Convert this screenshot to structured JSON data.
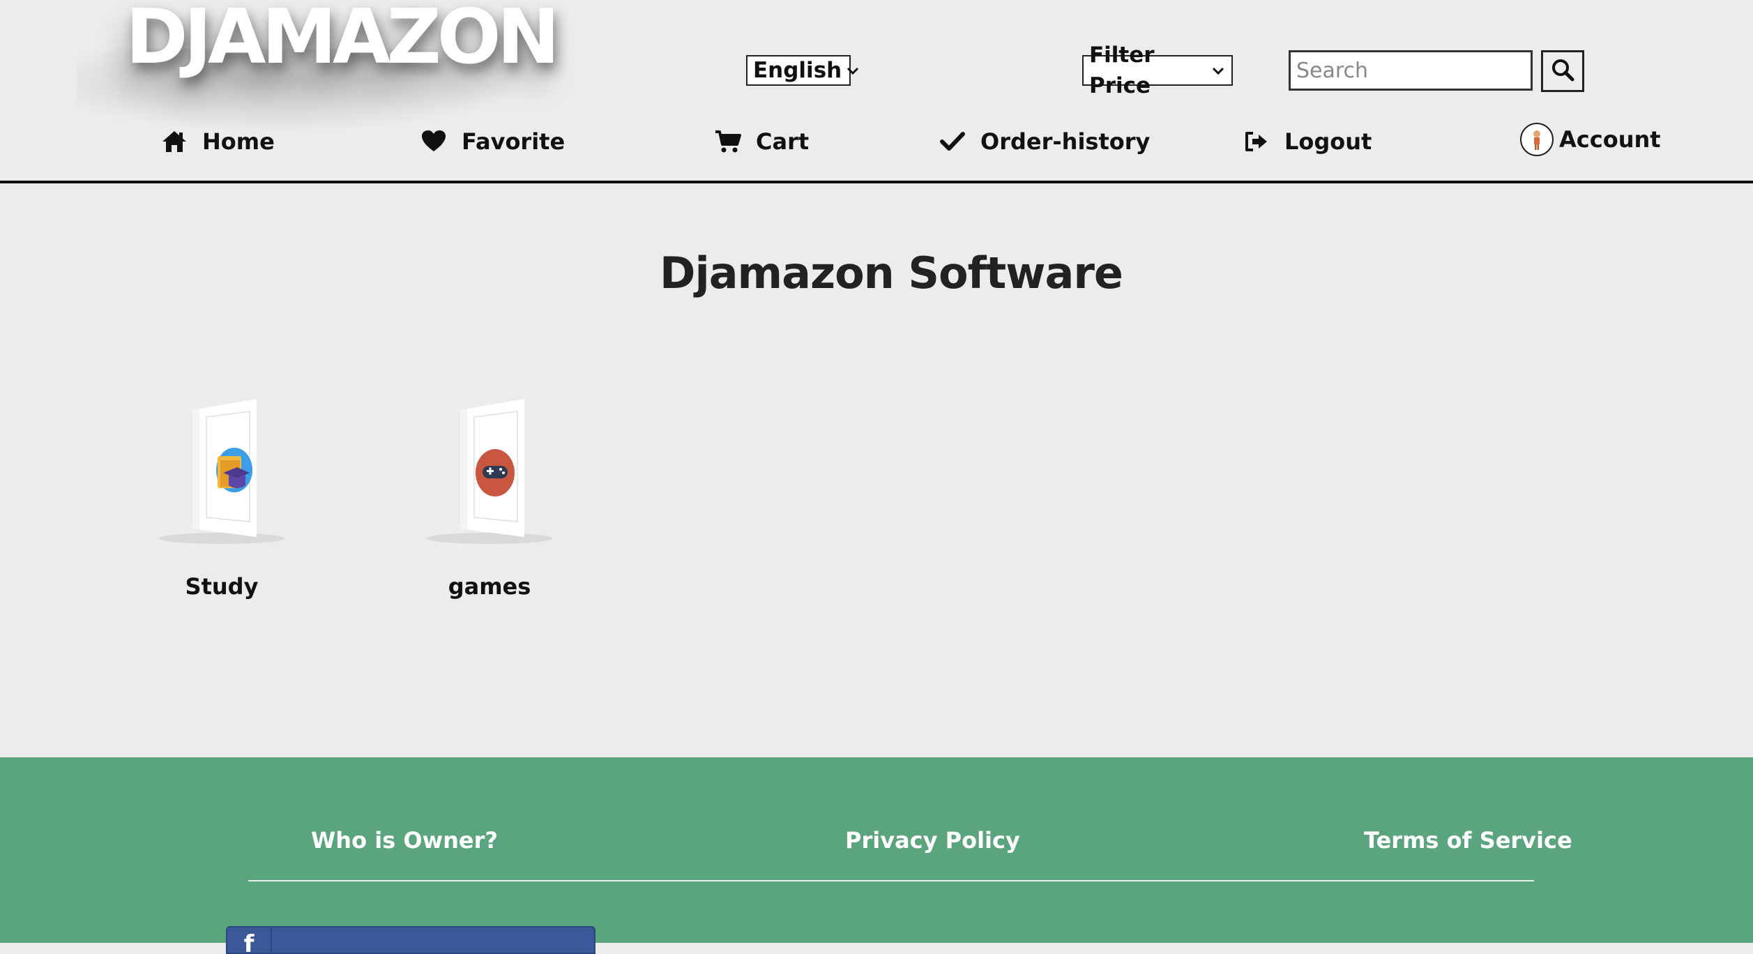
{
  "header": {
    "logo": "DJAMAZON",
    "language": {
      "selected": "English"
    },
    "price_filter": {
      "selected": "Filter Price"
    },
    "search": {
      "placeholder": "Search",
      "value": ""
    }
  },
  "nav": {
    "home": "Home",
    "favorite": "Favorite",
    "cart": "Cart",
    "order_history": "Order-history",
    "logout": "Logout",
    "account": "Account"
  },
  "main": {
    "title": "Djamazon Software",
    "categories": [
      {
        "label": "Study",
        "icon": "study-icon"
      },
      {
        "label": "games",
        "icon": "gamepad-icon"
      }
    ]
  },
  "footer": {
    "links": [
      "Who is Owner?",
      "Privacy Policy",
      "Terms of Service"
    ],
    "facebook_icon": "facebook-icon"
  },
  "colors": {
    "background": "#ececec",
    "footer": "#5ba57e",
    "facebook": "#3b5998"
  }
}
